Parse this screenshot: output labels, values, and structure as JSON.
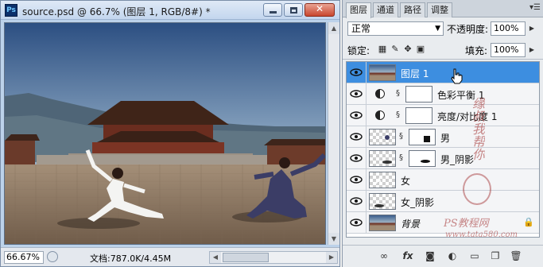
{
  "document": {
    "title": "source.psd @ 66.7% (图层 1, RGB/8#) *",
    "app_icon_text": "Ps",
    "zoom": "66.67%",
    "doc_info": "文档:787.0K/4.45M"
  },
  "layers_panel": {
    "tabs": [
      "图层",
      "通道",
      "路径",
      "调整"
    ],
    "active_tab": 0,
    "blend_mode": "正常",
    "opacity_label": "不透明度:",
    "opacity": "100%",
    "lock_label": "锁定:",
    "fill_label": "填充:",
    "fill": "100%",
    "layers": [
      {
        "name": "图层 1",
        "kind": "image",
        "selected": true
      },
      {
        "name": "色彩平衡 1",
        "kind": "adjustment",
        "selected": false
      },
      {
        "name": "亮度/对比度 1",
        "kind": "adjustment",
        "selected": false
      },
      {
        "name": "男",
        "kind": "masked",
        "selected": false
      },
      {
        "name": "男_阴影",
        "kind": "masked",
        "selected": false
      },
      {
        "name": "女",
        "kind": "plain",
        "selected": false
      },
      {
        "name": "女_阴影",
        "kind": "plain",
        "selected": false
      },
      {
        "name": "背景",
        "kind": "background",
        "selected": false,
        "locked": true
      }
    ]
  },
  "watermark": {
    "side_text": "缘叔我帮你",
    "site_name": "PS教程网",
    "site_url": "www.tata580.com"
  },
  "colors": {
    "selection": "#3d8ee0",
    "title_gradient_top": "#dfe9f6",
    "close_button": "#c8462f"
  }
}
